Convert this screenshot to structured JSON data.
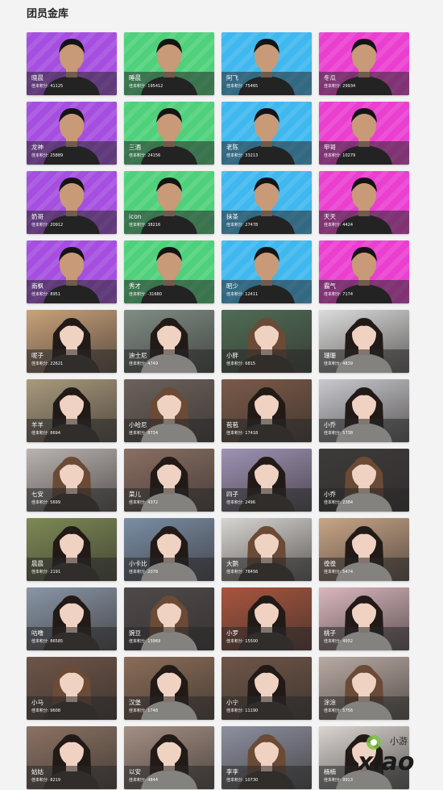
{
  "page": {
    "title": "团员金库"
  },
  "colors": {
    "purple": "#a54ee0",
    "green": "#4fd07b",
    "blue": "#3fb8ef",
    "pink": "#ea3fd0",
    "overlay": "rgba(40,40,40,0.55)"
  },
  "members": [
    {
      "name": "晓晨",
      "score": "佳本积分: 41125",
      "bg": "purple",
      "kind": "m"
    },
    {
      "name": "睡晨",
      "score": "佳本积分: 195412",
      "bg": "green",
      "kind": "m"
    },
    {
      "name": "阿飞",
      "score": "佳本积分: 75465",
      "bg": "blue",
      "kind": "m"
    },
    {
      "name": "冬瓜",
      "score": "佳本积分: 29934",
      "bg": "pink",
      "kind": "m"
    },
    {
      "name": "龙神",
      "score": "佳本积分: 25889",
      "bg": "purple",
      "kind": "m"
    },
    {
      "name": "三酒",
      "score": "佳本积分: 24156",
      "bg": "green",
      "kind": "m"
    },
    {
      "name": "老陈",
      "score": "佳本积分: 33213",
      "bg": "blue",
      "kind": "m"
    },
    {
      "name": "甲哥",
      "score": "佳本积分: 10279",
      "bg": "pink",
      "kind": "m"
    },
    {
      "name": "奶哥",
      "score": "佳本积分: 20912",
      "bg": "purple",
      "kind": "m"
    },
    {
      "name": "icon",
      "score": "佳本积分: 38216",
      "bg": "green",
      "kind": "m"
    },
    {
      "name": "抹茶",
      "score": "佳本积分: 27478",
      "bg": "blue",
      "kind": "m"
    },
    {
      "name": "天天",
      "score": "佳本积分: 4424",
      "bg": "pink",
      "kind": "m"
    },
    {
      "name": "南枫",
      "score": "佳本积分: 8951",
      "bg": "purple",
      "kind": "m"
    },
    {
      "name": "秀才",
      "score": "佳本积分: -31680",
      "bg": "green",
      "kind": "m"
    },
    {
      "name": "昭少",
      "score": "佳本积分: 12411",
      "bg": "blue",
      "kind": "m"
    },
    {
      "name": "霸气",
      "score": "佳本积分: 7174",
      "bg": "pink",
      "kind": "m"
    },
    {
      "name": "呢子",
      "score": "佳本积分: 22621",
      "bg": "#c9a27a",
      "kind": "f"
    },
    {
      "name": "迪士尼",
      "score": "佳本积分: 4749",
      "bg": "#7f8d85",
      "kind": "f"
    },
    {
      "name": "小胖",
      "score": "佳本积分: 6815",
      "bg": "#4f6d55",
      "kind": "f"
    },
    {
      "name": "珊珊",
      "score": "佳本积分: 4839",
      "bg": "#dcdcdc",
      "kind": "f"
    },
    {
      "name": "羊羊",
      "score": "佳本积分: 8694",
      "bg": "#a99a7d",
      "kind": "f"
    },
    {
      "name": "小哈尼",
      "score": "佳本积分: 8734",
      "bg": "#6d625c",
      "kind": "f"
    },
    {
      "name": "苞苞",
      "score": "佳本积分: 17418",
      "bg": "#7b5a48",
      "kind": "f"
    },
    {
      "name": "小乔",
      "score": "佳本积分: 5738",
      "bg": "#c9c9cf",
      "kind": "f"
    },
    {
      "name": "七安",
      "score": "佳本积分: 5699",
      "bg": "#b9b4b0",
      "kind": "f"
    },
    {
      "name": "菜儿",
      "score": "佳本积分: 4372",
      "bg": "#8a6f63",
      "kind": "f"
    },
    {
      "name": "四子",
      "score": "佳本积分: 2496",
      "bg": "#9e93b5",
      "kind": "f"
    },
    {
      "name": "小乔",
      "score": "佳本积分: 2384",
      "bg": "#3d3a3a",
      "kind": "f"
    },
    {
      "name": "晨晨",
      "score": "佳本积分: 2191",
      "bg": "#7d8a55",
      "kind": "f"
    },
    {
      "name": "小卡比",
      "score": "佳本积分: 2078",
      "bg": "#7a8ea6",
      "kind": "f"
    },
    {
      "name": "大鹅",
      "score": "佳本积分: 78456",
      "bg": "#d7d5d2",
      "kind": "f"
    },
    {
      "name": "徨徨",
      "score": "佳本积分: 5474",
      "bg": "#c8a587",
      "kind": "f"
    },
    {
      "name": "咕噜",
      "score": "佳本积分: 86585",
      "bg": "#8996a6",
      "kind": "f"
    },
    {
      "name": "豌豆",
      "score": "佳本积分: 13969",
      "bg": "#4f4a4a",
      "kind": "f"
    },
    {
      "name": "小罗",
      "score": "佳本积分: 15500",
      "bg": "#a9553e",
      "kind": "f"
    },
    {
      "name": "桃子",
      "score": "佳本积分: 4932",
      "bg": "#d9b7be",
      "kind": "f"
    },
    {
      "name": "小马",
      "score": "佳本积分: 9608",
      "bg": "#6e5548",
      "kind": "f"
    },
    {
      "name": "汉堡",
      "score": "佳本积分: 1748",
      "bg": "#8b6d58",
      "kind": "f"
    },
    {
      "name": "小宁",
      "score": "佳本积分: 11190",
      "bg": "#6f5648",
      "kind": "f"
    },
    {
      "name": "涂涂",
      "score": "佳本积分: 5756",
      "bg": "#b9aaa3",
      "kind": "f"
    },
    {
      "name": "姑姑",
      "score": "佳本积分: 8219",
      "bg": "#8b7263",
      "kind": "f"
    },
    {
      "name": "以安",
      "score": "佳本积分: 4844",
      "bg": "#a48f84",
      "kind": "f"
    },
    {
      "name": "李李",
      "score": "佳本积分: 10730",
      "bg": "#8d90a0",
      "kind": "f"
    },
    {
      "name": "楠楠",
      "score": "佳本积分: 9913",
      "bg": "#d9d4d0",
      "kind": "f"
    }
  ],
  "watermark": {
    "text": "xiao",
    "sub": "小游"
  }
}
